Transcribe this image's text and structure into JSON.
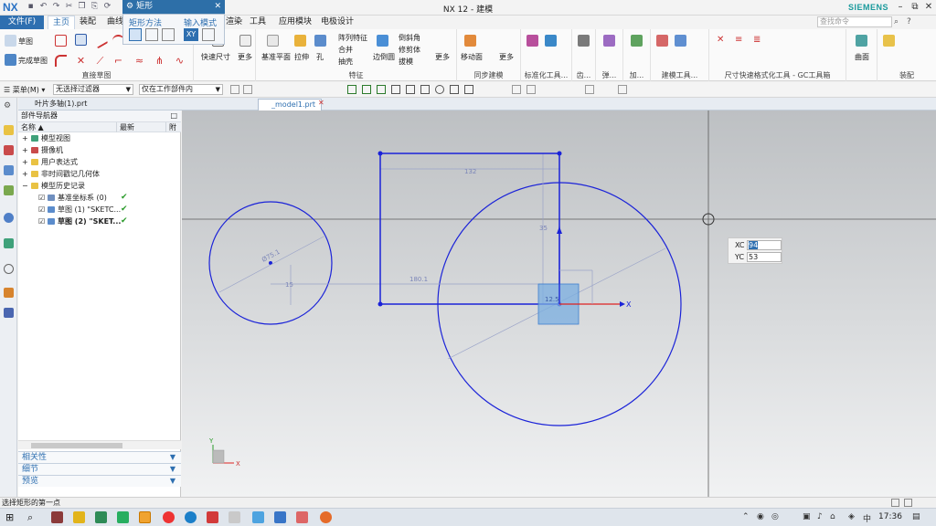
{
  "window": {
    "logo": "NX",
    "title": "NX 12 - 建模",
    "brand": "SIEMENS",
    "controls": [
      "–",
      "⧉",
      "✕"
    ]
  },
  "menu": {
    "file": "文件(F)",
    "tabs": [
      "主页",
      "装配",
      "曲线",
      "渲染",
      "工具",
      "应用模块",
      "电极设计"
    ],
    "search_placeholder": "查找命令"
  },
  "popup": {
    "title": "矩形",
    "method_label": "矩形方法",
    "input_mode_label": "输入模式",
    "xy_label": "XY"
  },
  "ribbon": {
    "sketch": "草图",
    "finish_sketch": "完成草图",
    "direct_sketch": "直接草图",
    "quick_dim": "快速尺寸",
    "more": "更多",
    "datum_plane": "基准平面",
    "extrude": "拉伸",
    "hole": "孔",
    "pattern": "阵列特征",
    "unite": "合并",
    "shell": "抽壳",
    "edge_blend": "边倒圆",
    "chamfer": "倒斜角",
    "trim_body": "修剪体",
    "draft": "拔模",
    "feature": "特征",
    "move_face": "移动面",
    "sync_modeling": "同步建模",
    "std_tools": "标准化工具...",
    "gear": "齿...",
    "spring": "弹...",
    "add": "加...",
    "modeling_tools": "建模工具...",
    "dim_tools": "尺寸快速格式化工具 - GC工具箱",
    "surface": "曲面",
    "assembly": "装配"
  },
  "selbar": {
    "menu": "菜单(M)",
    "filter": "无选择过滤器",
    "scope": "仅在工作部件内"
  },
  "doctabs": [
    "叶片多轴(1).prt",
    "_model1.prt"
  ],
  "navigator": {
    "title": "部件导航器",
    "col_name": "名称",
    "col_latest": "最新",
    "col_extra": "附",
    "nodes": [
      {
        "label": "模型视图",
        "indent": 0
      },
      {
        "label": "摄像机",
        "indent": 0
      },
      {
        "label": "用户表达式",
        "indent": 0
      },
      {
        "label": "非时间戳记几何体",
        "indent": 0
      },
      {
        "label": "模型历史记录",
        "indent": 0
      },
      {
        "label": "基准坐标系 (0)",
        "indent": 1,
        "check": "✔"
      },
      {
        "label": "草图 (1) \"SKETC...",
        "indent": 1,
        "check": "✔"
      },
      {
        "label": "草图 (2) \"SKET...",
        "indent": 1,
        "check": "✔"
      }
    ],
    "panels": [
      "相关性",
      "细节",
      "预览"
    ]
  },
  "sketch": {
    "left_circle_dim": "Ø75.1",
    "small_dim": "15",
    "rect_width_dim": "132",
    "horiz_dim": "180.1",
    "vert_dim": "35",
    "rect_corner_dim": "12.5",
    "axis_x": "X",
    "axis_y": "Y"
  },
  "coords": {
    "xc_label": "XC",
    "xc_value": "94",
    "yc_label": "YC",
    "yc_value": "53"
  },
  "status": "选择矩形的第一点",
  "taskbar": {
    "time": "17:36",
    "ime": "中"
  },
  "colors": {
    "accent": "#2e6fb0",
    "sketch_curve": "#1a22d8",
    "check_green": "#2b9b2b"
  }
}
